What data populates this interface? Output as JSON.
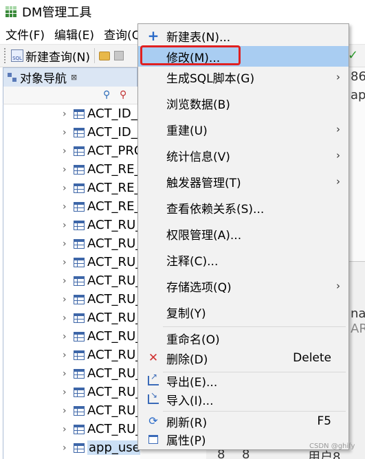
{
  "window": {
    "title": "DM管理工具"
  },
  "menubar": {
    "items": [
      "文件(F)",
      "编辑(E)",
      "查询(Q"
    ]
  },
  "toolbar": {
    "new_query": "新建查询(N)"
  },
  "panel": {
    "tab_label": "对象导航",
    "tab_close": "⊠"
  },
  "tree": {
    "items": [
      "ACT_ID_",
      "ACT_ID_",
      "ACT_PRO",
      "ACT_RE_",
      "ACT_RE_",
      "ACT_RE_",
      "ACT_RU_",
      "ACT_RU_",
      "ACT_RU_",
      "ACT_RU_",
      "ACT_RU_",
      "ACT_RU_",
      "ACT_RU_",
      "ACT_RU_",
      "ACT_RU_",
      "ACT_RU_",
      "ACT_RU_",
      "ACT_RU_",
      "app_use"
    ]
  },
  "background": {
    "text_86": "86",
    "text_app": "app",
    "text_na": "na",
    "text_ar": "AR",
    "text_8a": "8",
    "text_8b": "8",
    "text_user": "用户8"
  },
  "context_menu": {
    "new_table": "新建表(N)...",
    "modify": "修改(M)...",
    "gen_sql": "生成SQL脚本(G)",
    "browse": "浏览数据(B)",
    "rebuild": "重建(U)",
    "stats": "统计信息(V)",
    "trigger": "触发器管理(T)",
    "deps": "查看依赖关系(S)...",
    "privs": "权限管理(A)...",
    "comment": "注释(C)...",
    "storage": "存储选项(Q)",
    "copy": "复制(Y)",
    "rename": "重命名(O)",
    "delete": "删除(D)",
    "delete_shortcut": "Delete",
    "export": "导出(E)...",
    "import": "导入(I)...",
    "refresh": "刷新(R)",
    "refresh_shortcut": "F5",
    "properties": "属性(P)",
    "submenu_arrow": "›"
  },
  "watermark": "CSDN @ghify"
}
